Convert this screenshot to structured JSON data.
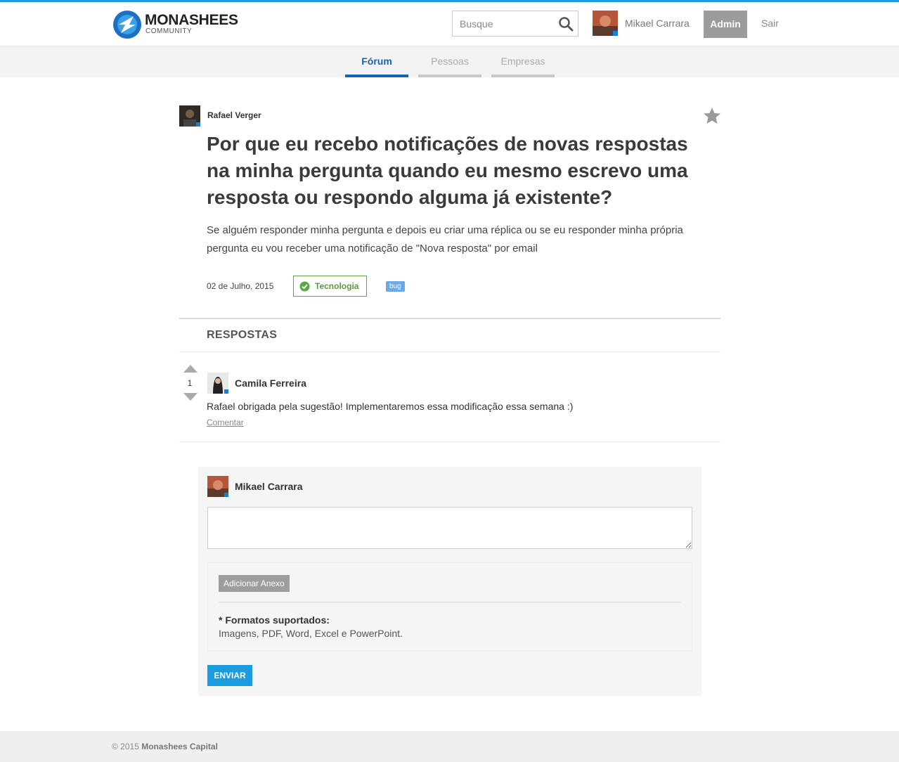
{
  "brand": {
    "name": "MONASHEES",
    "tagline": "COMMUNITY",
    "accent_color": "#1a9ce0",
    "logo_icon": "monashees-logo-icon"
  },
  "header": {
    "search_placeholder": "Busque",
    "user_name": "Mikael Carrara",
    "admin_label": "Admin",
    "logout_label": "Sair"
  },
  "nav": {
    "tabs": [
      {
        "label": "Fórum",
        "active": true
      },
      {
        "label": "Pessoas",
        "active": false
      },
      {
        "label": "Empresas",
        "active": false
      }
    ]
  },
  "question": {
    "author": "Rafael Verger",
    "title": "Por que eu recebo notificações de novas respostas na minha pergunta quando eu mesmo escrevo uma resposta ou respondo alguma já existente?",
    "body": "Se alguém responder minha pergunta e depois eu criar uma réplica ou se eu responder minha própria pergunta eu vou receber uma notificação de \"Nova resposta\" por email",
    "date": "02 de Julho, 2015",
    "category": "Tecnologia",
    "tag": "bug"
  },
  "answers": {
    "heading": "RESPOSTAS",
    "items": [
      {
        "votes": "1",
        "author": "Camila Ferreira",
        "text": "Rafael obrigada pela sugestão! Implementaremos essa modificação essa semana :)",
        "comment_label": "Comentar"
      }
    ]
  },
  "reply": {
    "author": "Mikael Carrara",
    "textarea_value": "",
    "attach_label": "Adicionar Anexo",
    "formats_title": "* Formatos suportados:",
    "formats_list": "Imagens, PDF, Word, Excel e PowerPoint.",
    "send_label": "ENVIAR"
  },
  "footer": {
    "copyright": "© 2015",
    "company": "Monashees Capital"
  }
}
